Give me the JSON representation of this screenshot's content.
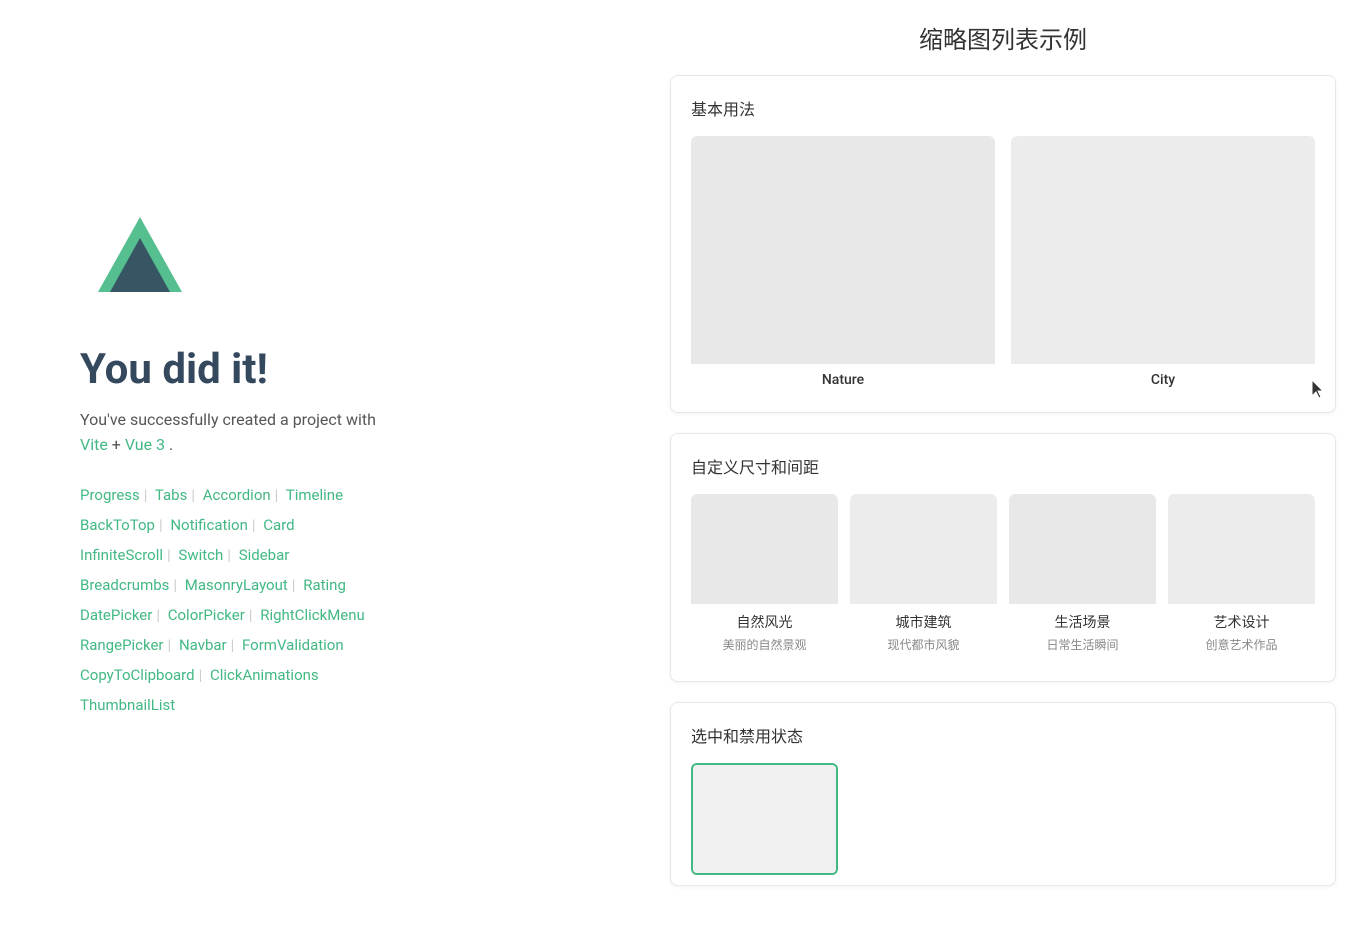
{
  "page": {
    "title": "缩略图列表示例"
  },
  "left": {
    "hero_title": "You did it!",
    "hero_text": "You've successfully created a project with",
    "hero_links_inline": "Vite + Vue 3.",
    "nav_items": [
      "Progress",
      "Tabs",
      "Accordion",
      "Timeline",
      "BackToTop",
      "Notification",
      "Card",
      "InfiniteScroll",
      "Switch",
      "Sidebar",
      "Breadcrumbs",
      "MasonryLayout",
      "Rating",
      "DatePicker",
      "ColorPicker",
      "RightClickMenu",
      "RangePicker",
      "Navbar",
      "FormValidation",
      "CopyToClipboard",
      "ClickAnimations",
      "ThumbnailList"
    ]
  },
  "sections": [
    {
      "id": "basic",
      "title": "基本用法",
      "grid": "2",
      "items": [
        {
          "label": "Nature",
          "desc": "",
          "bg": "nature-bg"
        },
        {
          "label": "City",
          "desc": "",
          "bg": "city-bg"
        }
      ]
    },
    {
      "id": "custom",
      "title": "自定义尺寸和间距",
      "grid": "4",
      "items": [
        {
          "label": "自然风光",
          "desc": "美丽的自然景观",
          "bg": "nature-bg"
        },
        {
          "label": "城市建筑",
          "desc": "现代都市风貌",
          "bg": "city-bg"
        },
        {
          "label": "生活场景",
          "desc": "日常生活瞬间",
          "bg": "nature-bg"
        },
        {
          "label": "艺术设计",
          "desc": "创意艺术作品",
          "bg": "city-bg"
        }
      ]
    },
    {
      "id": "selected",
      "title": "选中和禁用状态",
      "grid": "4",
      "items": [
        {
          "label": "",
          "desc": "",
          "bg": "nature-bg",
          "selected": true
        }
      ]
    }
  ]
}
